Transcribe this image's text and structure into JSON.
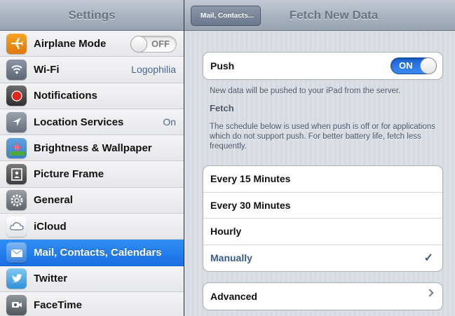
{
  "sidebar": {
    "title": "Settings",
    "items": [
      {
        "label": "Airplane Mode",
        "icon": "airplane-icon",
        "toggle": "OFF"
      },
      {
        "label": "Wi-Fi",
        "icon": "wifi-icon",
        "value": "Logophilia"
      },
      {
        "label": "Notifications",
        "icon": "notifications-icon"
      },
      {
        "label": "Location Services",
        "icon": "location-services-icon",
        "value": "On"
      },
      {
        "label": "Brightness & Wallpaper",
        "icon": "brightness-wallpaper-icon"
      },
      {
        "label": "Picture Frame",
        "icon": "picture-frame-icon"
      },
      {
        "label": "General",
        "icon": "gear-icon"
      },
      {
        "label": "iCloud",
        "icon": "icloud-icon"
      },
      {
        "label": "Mail, Contacts, Calendars",
        "icon": "mail-icon",
        "selected": true
      },
      {
        "label": "Twitter",
        "icon": "twitter-icon"
      },
      {
        "label": "FaceTime",
        "icon": "facetime-icon"
      }
    ]
  },
  "main": {
    "back_label": "Mail, Contacts...",
    "title": "Fetch New Data",
    "push": {
      "label": "Push",
      "toggle": "ON"
    },
    "push_footer": "New data will be pushed to your iPad from the server.",
    "fetch_header": "Fetch",
    "fetch_description": "The schedule below is used when push is off or for applications which do not support push. For better battery life, fetch less frequently.",
    "schedule_options": [
      {
        "label": "Every 15 Minutes"
      },
      {
        "label": "Every 30 Minutes"
      },
      {
        "label": "Hourly"
      },
      {
        "label": "Manually",
        "checked": true
      }
    ],
    "checkmark": "✓",
    "advanced_label": "Advanced"
  },
  "colors": {
    "accent": "#1a6fe3",
    "selected_text": "#3a5a8c"
  }
}
